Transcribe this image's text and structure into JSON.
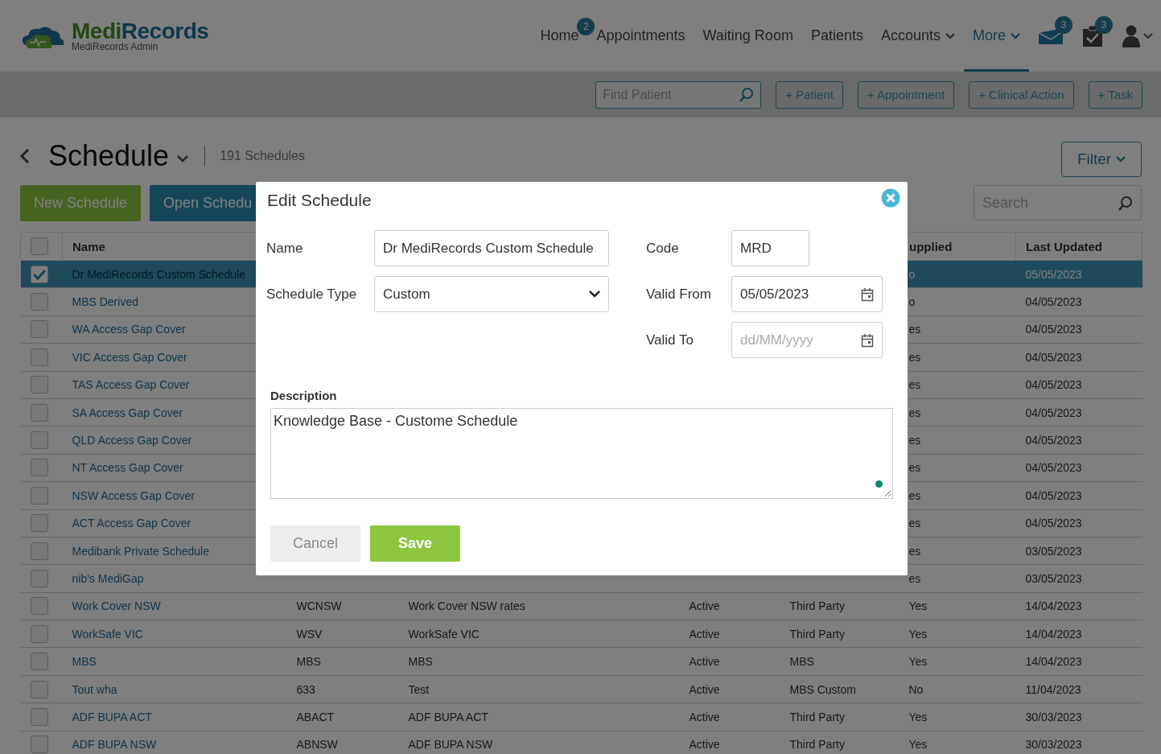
{
  "header": {
    "brand_first": "Medi",
    "brand_second": "Records",
    "subtitle": "MediRecords Admin",
    "nav": [
      {
        "label": "Home",
        "badge": "2",
        "dropdown": false,
        "selected": false
      },
      {
        "label": "Appointments",
        "dropdown": false,
        "selected": false
      },
      {
        "label": "Waiting Room",
        "dropdown": false,
        "selected": false
      },
      {
        "label": "Patients",
        "dropdown": false,
        "selected": false
      },
      {
        "label": "Accounts",
        "dropdown": true,
        "selected": false
      },
      {
        "label": "More",
        "dropdown": true,
        "selected": true
      }
    ],
    "icons": [
      {
        "kind": "mail",
        "badge": "3"
      },
      {
        "kind": "tasks",
        "badge": "3"
      },
      {
        "kind": "user"
      }
    ]
  },
  "toolbar": {
    "search": {
      "placeholder": "Find Patient"
    },
    "buttons": [
      "+ Patient",
      "+ Appointment",
      "+ Clinical Action",
      "+ Task"
    ]
  },
  "page": {
    "title": "Schedule",
    "count": "191 Schedules",
    "actions": [
      {
        "kind": "new",
        "label": "New Schedule"
      },
      {
        "kind": "open",
        "label": "Open Schedu"
      }
    ],
    "filter": "Filter",
    "search": {
      "placeholder": "Search"
    }
  },
  "table": {
    "headings": {
      "name": "Name",
      "supplied": "upplied",
      "last_updated": "Last Updated"
    },
    "header_checked": false,
    "rows": [
      {
        "selected": true,
        "name": "Dr MediRecords Custom Schedule",
        "supplied": "o",
        "last_updated": "05/05/2023"
      },
      {
        "selected": false,
        "name": "MBS Derived",
        "supplied": "o",
        "last_updated": "04/05/2023"
      },
      {
        "selected": false,
        "name": "WA Access Gap Cover",
        "supplied": "es",
        "last_updated": "04/05/2023"
      },
      {
        "selected": false,
        "name": "VIC Access Gap Cover",
        "supplied": "es",
        "last_updated": "04/05/2023"
      },
      {
        "selected": false,
        "name": "TAS Access Gap Cover",
        "supplied": "es",
        "last_updated": "04/05/2023"
      },
      {
        "selected": false,
        "name": "SA Access Gap Cover",
        "supplied": "es",
        "last_updated": "04/05/2023"
      },
      {
        "selected": false,
        "name": "QLD Access Gap Cover",
        "supplied": "es",
        "last_updated": "04/05/2023"
      },
      {
        "selected": false,
        "name": "NT Access Gap Cover",
        "supplied": "es",
        "last_updated": "04/05/2023"
      },
      {
        "selected": false,
        "name": "NSW Access Gap Cover",
        "supplied": "es",
        "last_updated": "04/05/2023"
      },
      {
        "selected": false,
        "name": "ACT Access Gap Cover",
        "supplied": "es",
        "last_updated": "04/05/2023"
      },
      {
        "selected": false,
        "name": "Medibank Private Schedule",
        "supplied": "es",
        "last_updated": "03/05/2023"
      },
      {
        "selected": false,
        "name": "nib's MediGap",
        "supplied": "es",
        "last_updated": "03/05/2023"
      },
      {
        "selected": false,
        "name": "Work Cover NSW",
        "code": "WCNSW",
        "description": "Work Cover NSW rates",
        "status": "Active",
        "type": "Third Party",
        "supplied": "Yes",
        "last_updated": "14/04/2023"
      },
      {
        "selected": false,
        "name": "WorkSafe VIC",
        "code": "WSV",
        "description": "WorkSafe VIC",
        "status": "Active",
        "type": "Third Party",
        "supplied": "Yes",
        "last_updated": "14/04/2023"
      },
      {
        "selected": false,
        "name": "MBS",
        "code": "MBS",
        "description": "MBS",
        "status": "Active",
        "type": "MBS",
        "supplied": "Yes",
        "last_updated": "14/04/2023"
      },
      {
        "selected": false,
        "name": "Tout wha",
        "code": "633",
        "description": "Test",
        "status": "Active",
        "type": "MBS Custom",
        "supplied": "No",
        "last_updated": "11/04/2023"
      },
      {
        "selected": false,
        "name": "ADF BUPA ACT",
        "code": "ABACT",
        "description": "ADF BUPA ACT",
        "status": "Active",
        "type": "Third Party",
        "supplied": "Yes",
        "last_updated": "30/03/2023"
      },
      {
        "selected": false,
        "name": "ADF BUPA NSW",
        "code": "ABNSW",
        "description": "ADF BUPA NSW",
        "status": "Active",
        "type": "Third Party",
        "supplied": "Yes",
        "last_updated": "30/03/2023"
      }
    ]
  },
  "modal": {
    "title": "Edit Schedule",
    "fields": {
      "name": {
        "label": "Name",
        "value": "Dr MediRecords Custom Schedule"
      },
      "schedule_type": {
        "label": "Schedule Type",
        "value": "Custom"
      },
      "code": {
        "label": "Code",
        "value": "MRD"
      },
      "valid_from": {
        "label": "Valid From",
        "value": "05/05/2023"
      },
      "valid_to": {
        "label": "Valid To",
        "placeholder": "dd/MM/yyyy"
      }
    },
    "description": {
      "label": "Description",
      "value": "Knowledge Base - Custome Schedule"
    },
    "buttons": [
      {
        "kind": "cancel",
        "label": "Cancel"
      },
      {
        "kind": "save",
        "label": "Save"
      }
    ]
  }
}
